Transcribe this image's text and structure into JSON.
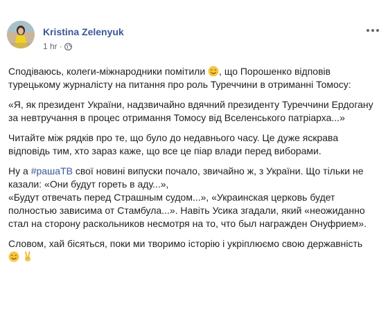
{
  "post": {
    "author": "Kristina Zelenyuk",
    "time": "1 hr",
    "separator": "·",
    "paragraphs": {
      "p1": "Сподіваюсь, колеги-міжнародники помітили",
      "p1_after": ", що Порошенко відповів турецькому журналісту на питання про роль Туреччини в отриманні Томосу:",
      "p2": "«Я, як президент України, надзвичайно вдячний президенту Туреччини Ердогану за невтручання в процес отримання Томосу від Вселенського патріарха...»",
      "p3": "Читайте між рядків про те, що було до недавнього часу. Це дуже яскрава відповідь тим, хто зараз каже, що все це піар влади перед виборами.",
      "p4_before": "Ну а ",
      "p4_hashtag": "#рашаТВ",
      "p4_after": " свої новині випуски почало, звичайно ж, з України. Що тільки не казали: «Они будут гореть в аду...»,",
      "p4_line2": "«Будут отвечать перед Страшным судом...», «Украинская церковь будет полностью зависима от Стамбула...». Навіть Усика згадали, який «неожиданно стал на сторону раскольников несмотря на то, что был награжден Онуфрием».",
      "p5": "Словом, хай бісяться, поки ми творимо історію і укріплюємо свою державність"
    }
  },
  "icons": {
    "avatar": "profile-photo",
    "globe": "globe-icon",
    "more": "more-options-icon",
    "emoji_smile": "smiling-face-icon",
    "emoji_victory": "victory-hand-icon"
  },
  "colors": {
    "link": "#385898",
    "text": "#1c1e21",
    "meta": "#616770"
  }
}
